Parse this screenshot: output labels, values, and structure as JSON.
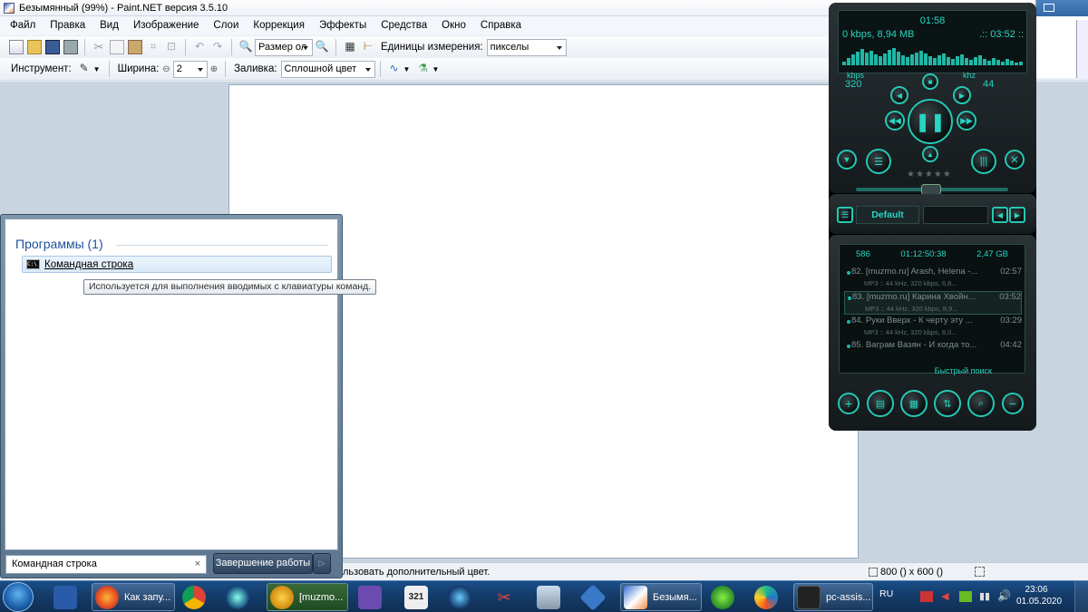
{
  "paint": {
    "title": "Безымянный (99%) - Paint.NET версия 3.5.10",
    "menu": [
      "Файл",
      "Правка",
      "Вид",
      "Изображение",
      "Слои",
      "Коррекция",
      "Эффекты",
      "Средства",
      "Окно",
      "Справка"
    ],
    "toolbar": {
      "zoom_value": "Размер ол",
      "units_label": "Единицы измерения:",
      "units_value": "пикселы",
      "tool_label": "Инструмент:",
      "width_label": "Ширина:",
      "width_value": "2",
      "fill_label": "Заливка:",
      "fill_value": "Сплошной цвет"
    },
    "status": {
      "hint": "льзовать дополнительный цвет.",
      "size": "800 () x 600 ()"
    }
  },
  "startmenu": {
    "section_title": "Программы (1)",
    "result_label": "Командная строка",
    "tooltip": "Используется для выполнения вводимых с клавиатуры команд.",
    "search_value": "Командная строка",
    "clear_glyph": "×",
    "shutdown_label": "Завершение работы",
    "shutdown_arrow": "▷"
  },
  "aimp": {
    "time": "01:58",
    "info_left": "0 kbps, 8,94 MB",
    "info_right": ".:: 03:52 ::",
    "kbps_label": "kbps",
    "khz_label": "khz",
    "bitrate": "320",
    "samplerate": "44",
    "rating": "★★★★★",
    "preset": "Default",
    "playlist": {
      "count": "586",
      "duration": "01:12:50:38",
      "size": "2,47 GB",
      "items": [
        {
          "title": "82. [muzmo.ru] Arash, Helena -...",
          "time": "02:57",
          "meta": "MP3 :: 44 kHz, 320 kbps, 6,8..."
        },
        {
          "title": "83. [muzmo.ru] Карина Хвойн...",
          "time": "03:52",
          "meta": "MP3 :: 44 kHz, 320 kbps, 8,9..."
        },
        {
          "title": "84. Руки Вверх - К черту эту ...",
          "time": "03:29",
          "meta": "MP3 :: 44 kHz, 320 kbps, 8,0..."
        },
        {
          "title": "85. Ваграм Вазян - И когда то...",
          "time": "04:42",
          "meta": ""
        }
      ],
      "quick_search": "Быстрый поиск"
    }
  },
  "taskbar": {
    "buttons": [
      "Как запу...",
      "[muzmo...",
      "Безымя...",
      "pc-assis..."
    ],
    "lang": "RU",
    "time": "23:06",
    "date": "01.05.2020"
  },
  "colors": {
    "accent": "#26d6c2",
    "taskbar": "#143c6a",
    "link": "#1e4f9c"
  }
}
